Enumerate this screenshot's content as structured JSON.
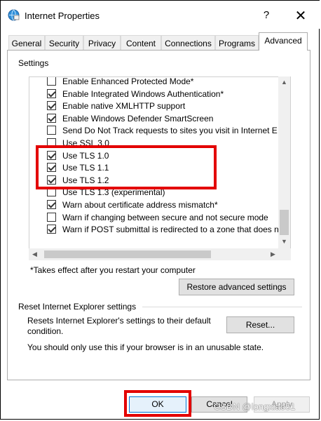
{
  "window": {
    "title": "Internet Properties",
    "help_icon": "?",
    "close_icon": "✕"
  },
  "tabs": [
    {
      "label": "General"
    },
    {
      "label": "Security"
    },
    {
      "label": "Privacy"
    },
    {
      "label": "Content"
    },
    {
      "label": "Connections"
    },
    {
      "label": "Programs"
    },
    {
      "label": "Advanced"
    }
  ],
  "settings": {
    "group_label": "Settings",
    "items": [
      {
        "label": "Enable Enhanced Protected Mode*",
        "checked": false
      },
      {
        "label": "Enable Integrated Windows Authentication*",
        "checked": true
      },
      {
        "label": "Enable native XMLHTTP support",
        "checked": true
      },
      {
        "label": "Enable Windows Defender SmartScreen",
        "checked": true
      },
      {
        "label": "Send Do Not Track requests to sites you visit in Internet E",
        "checked": false
      },
      {
        "label": "Use SSL 3.0",
        "checked": false
      },
      {
        "label": "Use TLS 1.0",
        "checked": true
      },
      {
        "label": "Use TLS 1.1",
        "checked": true
      },
      {
        "label": "Use TLS 1.2",
        "checked": true
      },
      {
        "label": "Use TLS 1.3 (experimental)",
        "checked": false
      },
      {
        "label": "Warn about certificate address mismatch*",
        "checked": true
      },
      {
        "label": "Warn if changing between secure and not secure mode",
        "checked": false
      },
      {
        "label": "Warn if POST submittal is redirected to a zone that does n",
        "checked": true
      }
    ],
    "footnote": "*Takes effect after you restart your computer",
    "restore_button": "Restore advanced settings"
  },
  "reset": {
    "group_label": "Reset Internet Explorer settings",
    "description": "Resets Internet Explorer's settings to their default condition.",
    "warning": "You should only use this if your browser is in an unusable state.",
    "reset_button": "Reset..."
  },
  "footer": {
    "ok": "OK",
    "cancel": "Cancel",
    "apply": "Apply",
    "watermark": "CSDN @longxiao51"
  },
  "colors": {
    "highlight": "#e30000",
    "ok_border": "#0078d7"
  }
}
